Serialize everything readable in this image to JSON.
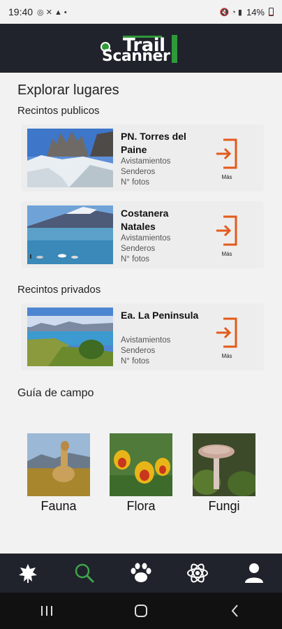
{
  "status": {
    "time": "19:40",
    "battery": "14%"
  },
  "app": {
    "logo_line1": "Trail",
    "logo_line2": "Scanner"
  },
  "page": {
    "title": "Explorar lugares"
  },
  "sections": {
    "public_heading": "Recintos publicos",
    "private_heading": "Recintos privados",
    "guide_heading": "Guía de campo"
  },
  "places": [
    {
      "title": "PN. Torres del Paine",
      "stats": [
        "Avistamientos",
        "Senderos",
        "N° fotos"
      ],
      "more": "Más"
    },
    {
      "title": "Costanera Natales",
      "stats": [
        "Avistamientos",
        "Senderos",
        "N° fotos"
      ],
      "more": "Más"
    },
    {
      "title": "Ea. La Peninsula",
      "stats": [
        "Avistamientos",
        "Senderos",
        "N° fotos"
      ],
      "more": "Más"
    }
  ],
  "guide": [
    {
      "label": "Fauna"
    },
    {
      "label": "Flora"
    },
    {
      "label": "Fungi"
    }
  ],
  "nav": [
    "leaf-icon",
    "search-icon",
    "paw-icon",
    "atom-icon",
    "user-icon"
  ],
  "colors": {
    "bar": "#20232b",
    "accent": "#e35a1b",
    "active": "#3fa34d",
    "background": "#f2f2f2"
  }
}
